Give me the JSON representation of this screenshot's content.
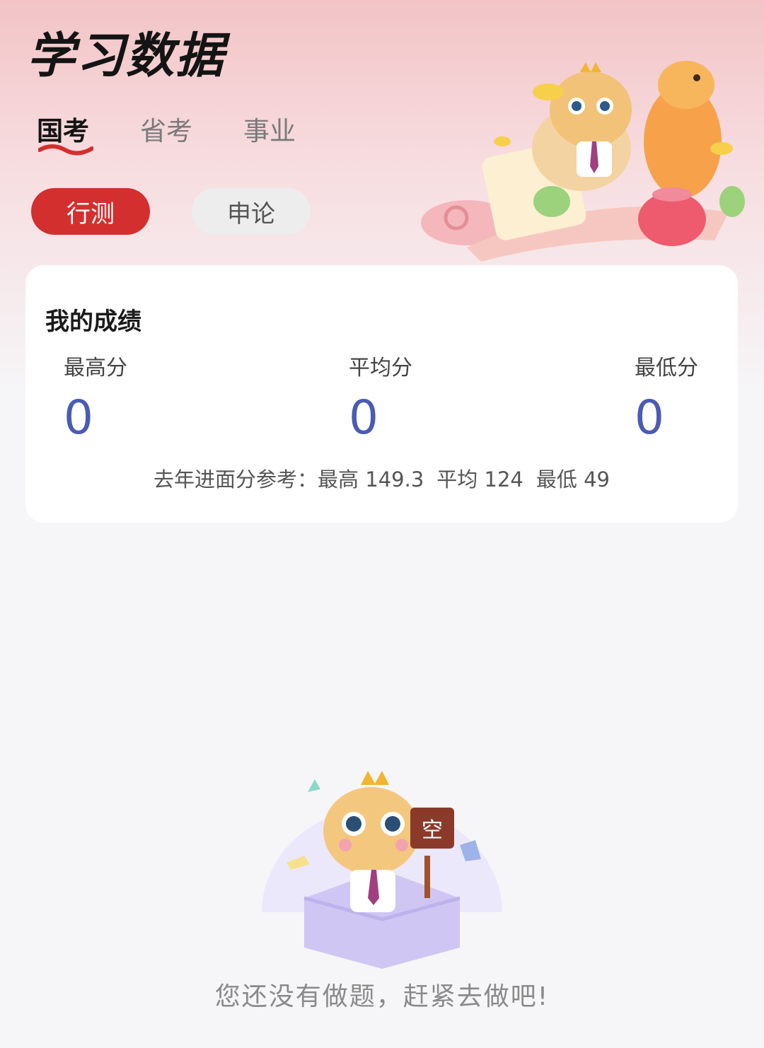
{
  "header": {
    "title": "学习数据"
  },
  "exam_tabs": [
    {
      "label": "国考",
      "active": true
    },
    {
      "label": "省考",
      "active": false
    },
    {
      "label": "事业",
      "active": false
    }
  ],
  "subjects": [
    {
      "label": "行测",
      "active": true
    },
    {
      "label": "申论",
      "active": false
    }
  ],
  "score_card": {
    "title": "我的成绩",
    "stats": [
      {
        "label": "最高分",
        "value": "0"
      },
      {
        "label": "平均分",
        "value": "0"
      },
      {
        "label": "最低分",
        "value": "0"
      }
    ],
    "reference": {
      "prefix": "去年进面分参考：",
      "items": [
        "最高 149.3",
        "平均 124",
        "最低 49"
      ]
    }
  },
  "empty_state": {
    "sign_text": "空",
    "message": "您还没有做题，赶紧去做吧!"
  },
  "colors": {
    "accent": "#d32f2f",
    "score": "#4a5bb4",
    "header_gradient_top": "#f2c4c6"
  }
}
